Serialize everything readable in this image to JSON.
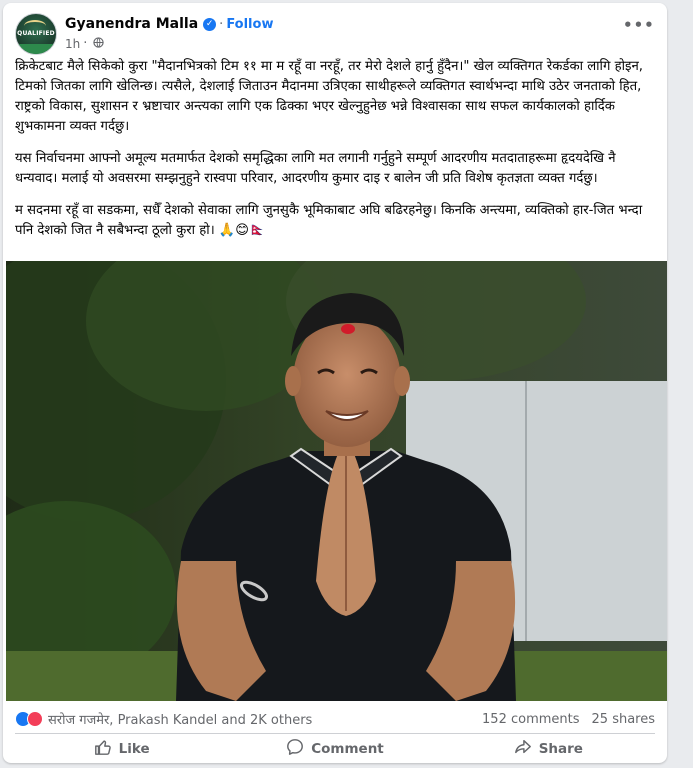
{
  "post": {
    "author": "Gyanendra Malla",
    "follow_label": "Follow",
    "separator": "·",
    "time": "1h",
    "avatar_badge_text": "QUALIFIED",
    "paragraphs": [
      "क्रिकेटबाट मैले सिकेको कुरा \"मैदानभित्रको टिम ११ मा म रहूँ वा नरहूँ, तर मेरो देशले हार्नु हुँदैन।\" खेल व्यक्तिगत रेकर्डका लागि होइन, टिमको जितका लागि खेलिन्छ। त्यसैले, देशलाई जिताउन मैदानमा उत्रिएका साथीहरूले व्यक्तिगत स्वार्थभन्दा माथि उठेर जनताको हित, राष्ट्रको विकास, सुशासन र भ्रष्टाचार अन्त्यका लागि एक ढिक्का भएर खेल्नुहुनेछ भन्ने विश्वासका साथ सफल कार्यकालको हार्दिक शुभकामना व्यक्त गर्दछु।",
      "यस निर्वाचनमा आफ्नो अमूल्य मतमार्फत देशको समृद्धिका लागि मत लगानी गर्नुहुने सम्पूर्ण आदरणीय मतदाताहरूमा हृदयदेखि नै धन्यवाद। मलाई यो अवसरमा सम्झनुहुने रास्वपा परिवार, आदरणीय कुमार दाइ र बालेन जी प्रति विशेष कृतज्ञता व्यक्त गर्दछु।",
      "म सदनमा रहूँ वा सडकमा, सधैँ देशको सेवाका लागि जुनसुकै भूमिकाबाट अघि बढिरहनेछु। किनकि अन्त्यमा, व्यक्तिको हार-जित भन्दा पनि देशको जित नै सबैभन्दा ठूलो कुरा हो। 🙏😊🇳🇵"
    ]
  },
  "reactions": {
    "names": "सरोज गजमेर, Prakash Kandel and 2K others",
    "comments": "152 comments",
    "shares": "25 shares"
  },
  "actions": {
    "like": "Like",
    "comment": "Comment",
    "share": "Share"
  },
  "icons": [
    "verified-badge-icon",
    "globe-icon",
    "more-options-icon",
    "like-reaction-icon",
    "love-reaction-icon",
    "like-icon",
    "comment-icon",
    "share-icon"
  ],
  "colors": {
    "accent": "#1877f2",
    "secondary_text": "#65676b",
    "love": "#f33e58"
  }
}
